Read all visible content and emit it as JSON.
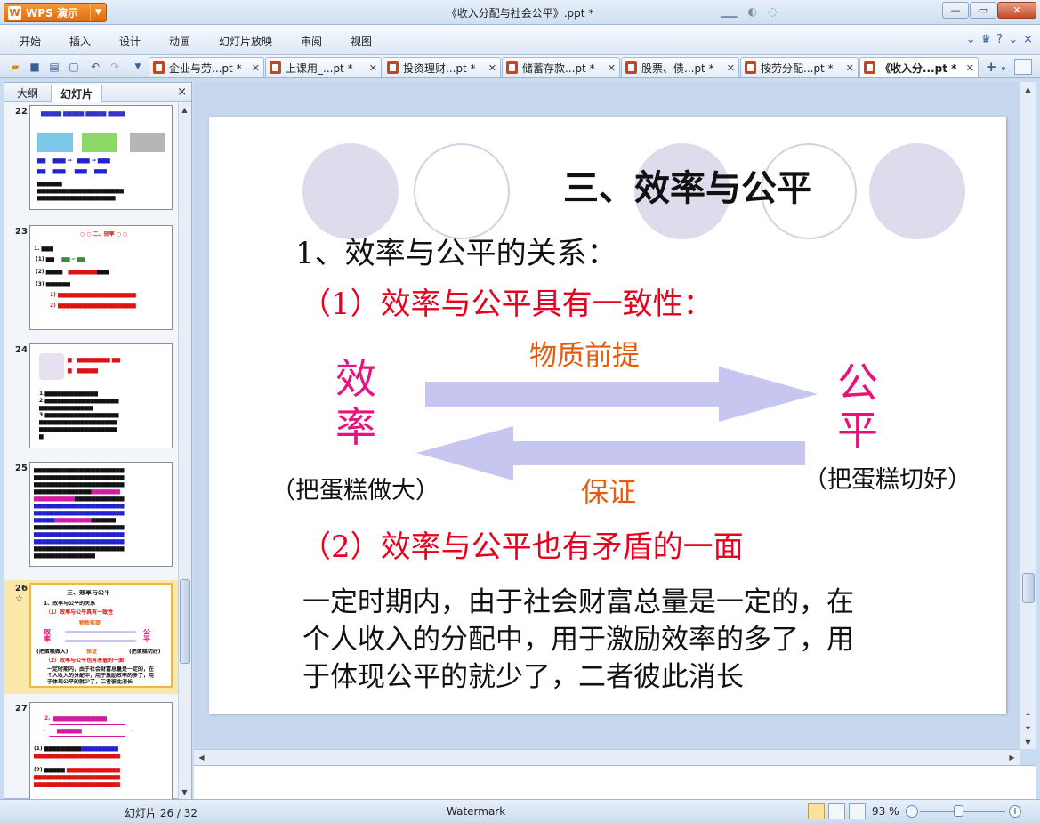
{
  "app": {
    "name": "WPS 演示",
    "doc_title": "《收入分配与社会公平》.ppt *"
  },
  "menu": [
    "开始",
    "插入",
    "设计",
    "动画",
    "幻灯片放映",
    "审阅",
    "视图"
  ],
  "doc_tabs": [
    {
      "label": "企业与劳...pt *",
      "active": false
    },
    {
      "label": "上课用_...pt *",
      "active": false
    },
    {
      "label": "投资理财...pt *",
      "active": false
    },
    {
      "label": "储蓄存款...pt *",
      "active": false
    },
    {
      "label": "股票、债...pt *",
      "active": false
    },
    {
      "label": "按劳分配...pt *",
      "active": false
    },
    {
      "label": "《收入分...pt *",
      "active": true
    }
  ],
  "left_panel": {
    "tabs": [
      "大纲",
      "幻灯片"
    ],
    "active_tab": "幻灯片",
    "close": "×"
  },
  "thumbnails": [
    {
      "num": "22",
      "selected": false
    },
    {
      "num": "23",
      "selected": false
    },
    {
      "num": "24",
      "selected": false
    },
    {
      "num": "25",
      "selected": false
    },
    {
      "num": "26",
      "selected": true,
      "star": "☆"
    },
    {
      "num": "27",
      "selected": false
    }
  ],
  "slide": {
    "title": "三、效率与公平",
    "point1": "1、效率与公平的关系：",
    "sub1": "（1）效率与公平具有一致性：",
    "arrow_top_label": "物质前提",
    "arrow_bottom_label": "保证",
    "left_word_1": "效",
    "left_word_2": "率",
    "right_word_1": "公",
    "right_word_2": "平",
    "left_caption": "（把蛋糕做大）",
    "right_caption": "（把蛋糕切好）",
    "sub2": "（2）效率与公平也有矛盾的一面",
    "body_1": "一定时期内，由于社会财富总量是一定的，在",
    "body_2": "个人收入的分配中，用于激励效率的多了，用",
    "body_3": "于体现公平的就少了，二者彼此消长",
    "colors": {
      "red": "#e8001c",
      "pink": "#e8127a",
      "orange": "#e85a0c",
      "arrow": "#c6c6f0"
    }
  },
  "status": {
    "slide_pos": "幻灯片 26 / 32",
    "watermark": "Watermark",
    "zoom": "93 %"
  }
}
